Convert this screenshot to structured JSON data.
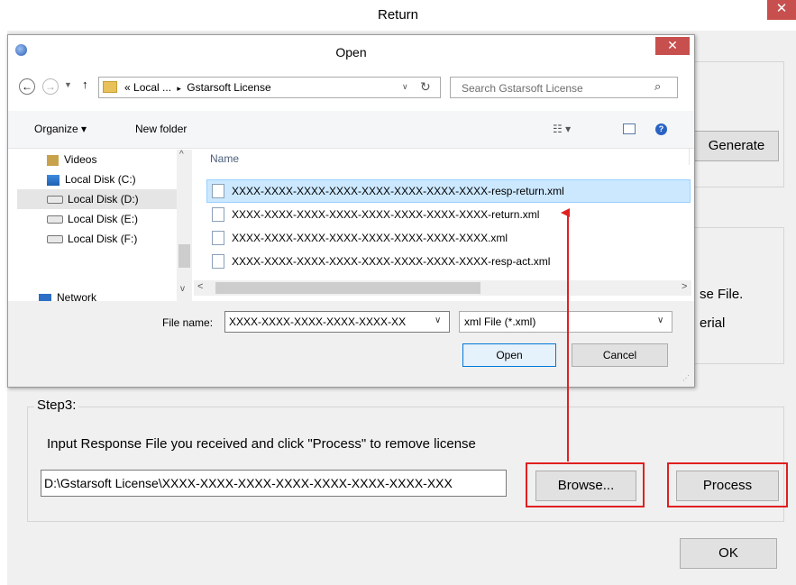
{
  "return_dialog": {
    "title": "Return",
    "close_glyph": "✕",
    "generate_label": "Generate",
    "partial_text_1": "se File.",
    "partial_text_2": "erial",
    "step3": {
      "legend": "Step3:",
      "instruction": "Input Response File you received and click \"Process\" to remove license",
      "path_value": "D:\\Gstarsoft License\\XXXX-XXXX-XXXX-XXXX-XXXX-XXXX-XXXX-XXX",
      "browse_label": "Browse...",
      "process_label": "Process"
    },
    "ok_label": "OK"
  },
  "open_dialog": {
    "title": "Open",
    "close_glyph": "✕",
    "breadcrumb": {
      "prefix": "«",
      "part1": "Local ...",
      "separator": "▸",
      "part2": "Gstarsoft License"
    },
    "search_placeholder": "Search Gstarsoft License",
    "organize_label": "Organize ▾",
    "new_folder_label": "New folder",
    "column_name": "Name",
    "nav_items": [
      {
        "label": "Videos"
      },
      {
        "label": "Local Disk (C:)"
      },
      {
        "label": "Local Disk (D:)"
      },
      {
        "label": "Local Disk (E:)"
      },
      {
        "label": "Local Disk (F:)"
      },
      {
        "label": "Network"
      }
    ],
    "files": [
      {
        "name": "XXXX-XXXX-XXXX-XXXX-XXXX-XXXX-XXXX-XXXX-resp-return.xml"
      },
      {
        "name": "XXXX-XXXX-XXXX-XXXX-XXXX-XXXX-XXXX-XXXX-return.xml"
      },
      {
        "name": "XXXX-XXXX-XXXX-XXXX-XXXX-XXXX-XXXX-XXXX.xml"
      },
      {
        "name": "XXXX-XXXX-XXXX-XXXX-XXXX-XXXX-XXXX-XXXX-resp-act.xml"
      }
    ],
    "file_name_label": "File name:",
    "file_name_value": "XXXX-XXXX-XXXX-XXXX-XXXX-XX",
    "file_type_value": "xml File (*.xml)",
    "open_label": "Open",
    "cancel_label": "Cancel"
  },
  "colors": {
    "highlight_red": "#e02020",
    "selection_blue": "#cce8ff",
    "close_red": "#c7504e"
  }
}
